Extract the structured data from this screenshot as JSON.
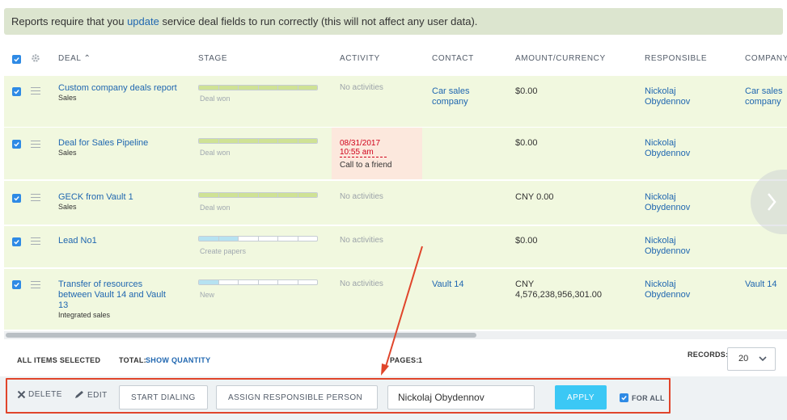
{
  "notice": {
    "before": "Reports require that you ",
    "link": "update",
    "after": " service deal fields to run correctly (this will not affect any user data)."
  },
  "columns": {
    "deal": "DEAL",
    "stage": "STAGE",
    "activity": "ACTIVITY",
    "contact": "CONTACT",
    "amount": "AMOUNT/CURRENCY",
    "responsible": "RESPONSIBLE",
    "company": "COMPANY"
  },
  "rows": [
    {
      "name": "Custom company deals report",
      "category": "Sales",
      "stage_label": "Deal won",
      "activity": "No activities",
      "contact": "Car sales company",
      "amount": "$0.00",
      "responsible": "Nickolaj Obydennov",
      "company": "Car sales company"
    },
    {
      "name": "Deal for Sales Pipeline",
      "category": "Sales",
      "stage_label": "Deal won",
      "activity_date": "08/31/2017 10:55 am",
      "activity_task": "Call to a friend",
      "amount": "$0.00",
      "responsible": "Nickolaj Obydennov"
    },
    {
      "name": "GECK from Vault 1",
      "category": "Sales",
      "stage_label": "Deal won",
      "activity": "No activities",
      "amount": "CNY 0.00",
      "responsible": "Nickolaj Obydennov"
    },
    {
      "name": "Lead No1",
      "stage_label": "Create papers",
      "activity": "No activities",
      "amount": "$0.00",
      "responsible": "Nickolaj Obydennov"
    },
    {
      "name": "Transfer of resources between Vault 14 and Vault 13",
      "category": "Integrated sales",
      "stage_label": "New",
      "activity": "No activities",
      "contact": "Vault 14",
      "amount": "CNY 4,576,238,956,301.00",
      "responsible": "Nickolaj Obydennov",
      "company": "Vault 14"
    }
  ],
  "footer": {
    "all_selected": "ALL ITEMS SELECTED",
    "total_label": "TOTAL:",
    "show_quantity": "SHOW QUANTITY",
    "pages_label": "PAGES:",
    "pages_value": "1",
    "records_label": "RECORDS:",
    "records_value": "20"
  },
  "actions": {
    "delete": "DELETE",
    "edit": "EDIT",
    "start_dialing": "START DIALING",
    "assign": "ASSIGN RESPONSIBLE PERSON",
    "assignee": "Nickolaj Obydennov",
    "apply": "APPLY",
    "for_all": "FOR ALL"
  },
  "colors": {
    "accent": "#2067b0",
    "row_bg": "#f1f8df",
    "apply_bg": "#3bc8f5",
    "highlight": "#e0452b"
  }
}
